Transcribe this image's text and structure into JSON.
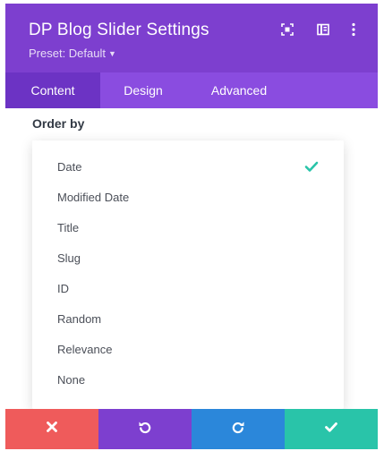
{
  "modal": {
    "title": "DP Blog Slider Settings",
    "preset_label": "Preset: Default",
    "header_icons": [
      "expand-icon",
      "sidebar-layout-icon",
      "more-vertical-icon"
    ]
  },
  "tabs": [
    {
      "label": "Content",
      "active": true
    },
    {
      "label": "Design",
      "active": false
    },
    {
      "label": "Advanced",
      "active": false
    }
  ],
  "field": {
    "label": "Order by",
    "selected": "Date",
    "options": [
      "Date",
      "Modified Date",
      "Title",
      "Slug",
      "ID",
      "Random",
      "Relevance",
      "None"
    ]
  },
  "footer": {
    "buttons": [
      {
        "name": "discard",
        "icon": "close-icon",
        "color": "#ef5b5b"
      },
      {
        "name": "undo",
        "icon": "undo-icon",
        "color": "#7d3fcf"
      },
      {
        "name": "redo",
        "icon": "redo-icon",
        "color": "#2b87da"
      },
      {
        "name": "save",
        "icon": "check-icon",
        "color": "#29c4a9"
      }
    ]
  },
  "colors": {
    "header": "#7d3fcf",
    "tabs_bar": "#8a4ce0",
    "active_tab": "#6c33c4",
    "check": "#29c4a9"
  }
}
